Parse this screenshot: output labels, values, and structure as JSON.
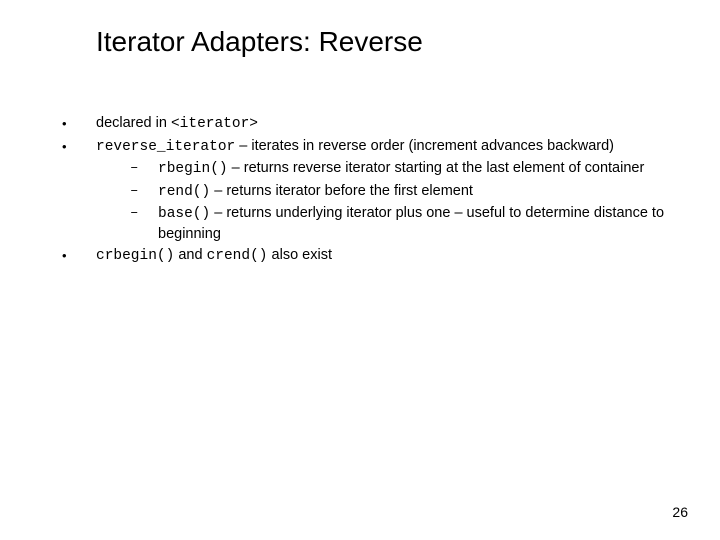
{
  "title": "Iterator Adapters: Reverse",
  "b1": {
    "pre": "declared in ",
    "code": "<iterator>"
  },
  "b2": {
    "code": "reverse_iterator",
    "rest": " – iterates in reverse order (increment advances backward)"
  },
  "b2a": {
    "code": "rbegin()",
    "rest": " – returns reverse iterator starting at the last element of container"
  },
  "b2b": {
    "code": "rend()",
    "rest": " – returns iterator before the first element"
  },
  "b2c": {
    "code": "base()",
    "rest": " – returns underlying iterator plus one – useful to determine distance to beginning"
  },
  "b3": {
    "c1": "crbegin()",
    "mid": " and ",
    "c2": "crend()",
    "rest": " also exist"
  },
  "pagenum": "26",
  "glyphs": {
    "dot": "•",
    "dash": "–"
  }
}
